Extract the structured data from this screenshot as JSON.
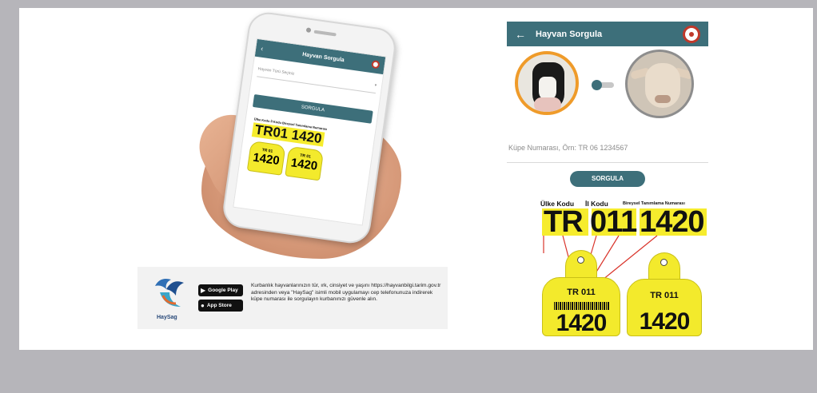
{
  "left_phone": {
    "title": "Hayvan Sorgula",
    "back_glyph": "‹",
    "select_placeholder": "Hayvan Türü Seçiniz",
    "select_arrow": "▾",
    "button_label": "SORGULA",
    "tag_header": "Ülke Kodu  İl Kodu  Bireysel Tanımlama Numarası",
    "tag_main": "TR01 1420",
    "ear_small": "TR 01",
    "ear_big": "1420"
  },
  "banner": {
    "logo_name": "HaySag",
    "google_play_label": "Google Play",
    "app_store_label": "App Store",
    "text": "Kurbanlık hayvanlarınızın tür, ırk, cinsiyet ve yaşını https://hayvanbilgi.tarim.gov.tr adresinden veya \"HaySag\" isimli mobil uygulamayı cep telefonunuza indirerek küpe numarası ile sorgulayın kurbanınızı güvenle alın."
  },
  "app": {
    "title": "Hayvan Sorgula",
    "back_glyph": "←",
    "ear_input_placeholder": "Küpe Numarası, Örn: TR 06 1234567",
    "button_label": "SORGULA",
    "tag": {
      "label_country": "Ülke Kodu",
      "label_city": "İl Kodu",
      "label_individual": "Bireysel Tanımlama Numarası",
      "part_country": "TR",
      "part_city": "011",
      "part_individual": "1420",
      "ear_small_1": "TR 011",
      "ear_big_1": "1420",
      "ear_small_2": "TR 011",
      "ear_big_2": "1420"
    }
  },
  "colors": {
    "app_bar": "#3d6f7a",
    "tag_yellow": "#f6ec2d",
    "cow_ring": "#ef9b2a",
    "line_red": "#d9342b"
  },
  "icons": {
    "google_play": "play-triangle",
    "app_store": "apple"
  }
}
